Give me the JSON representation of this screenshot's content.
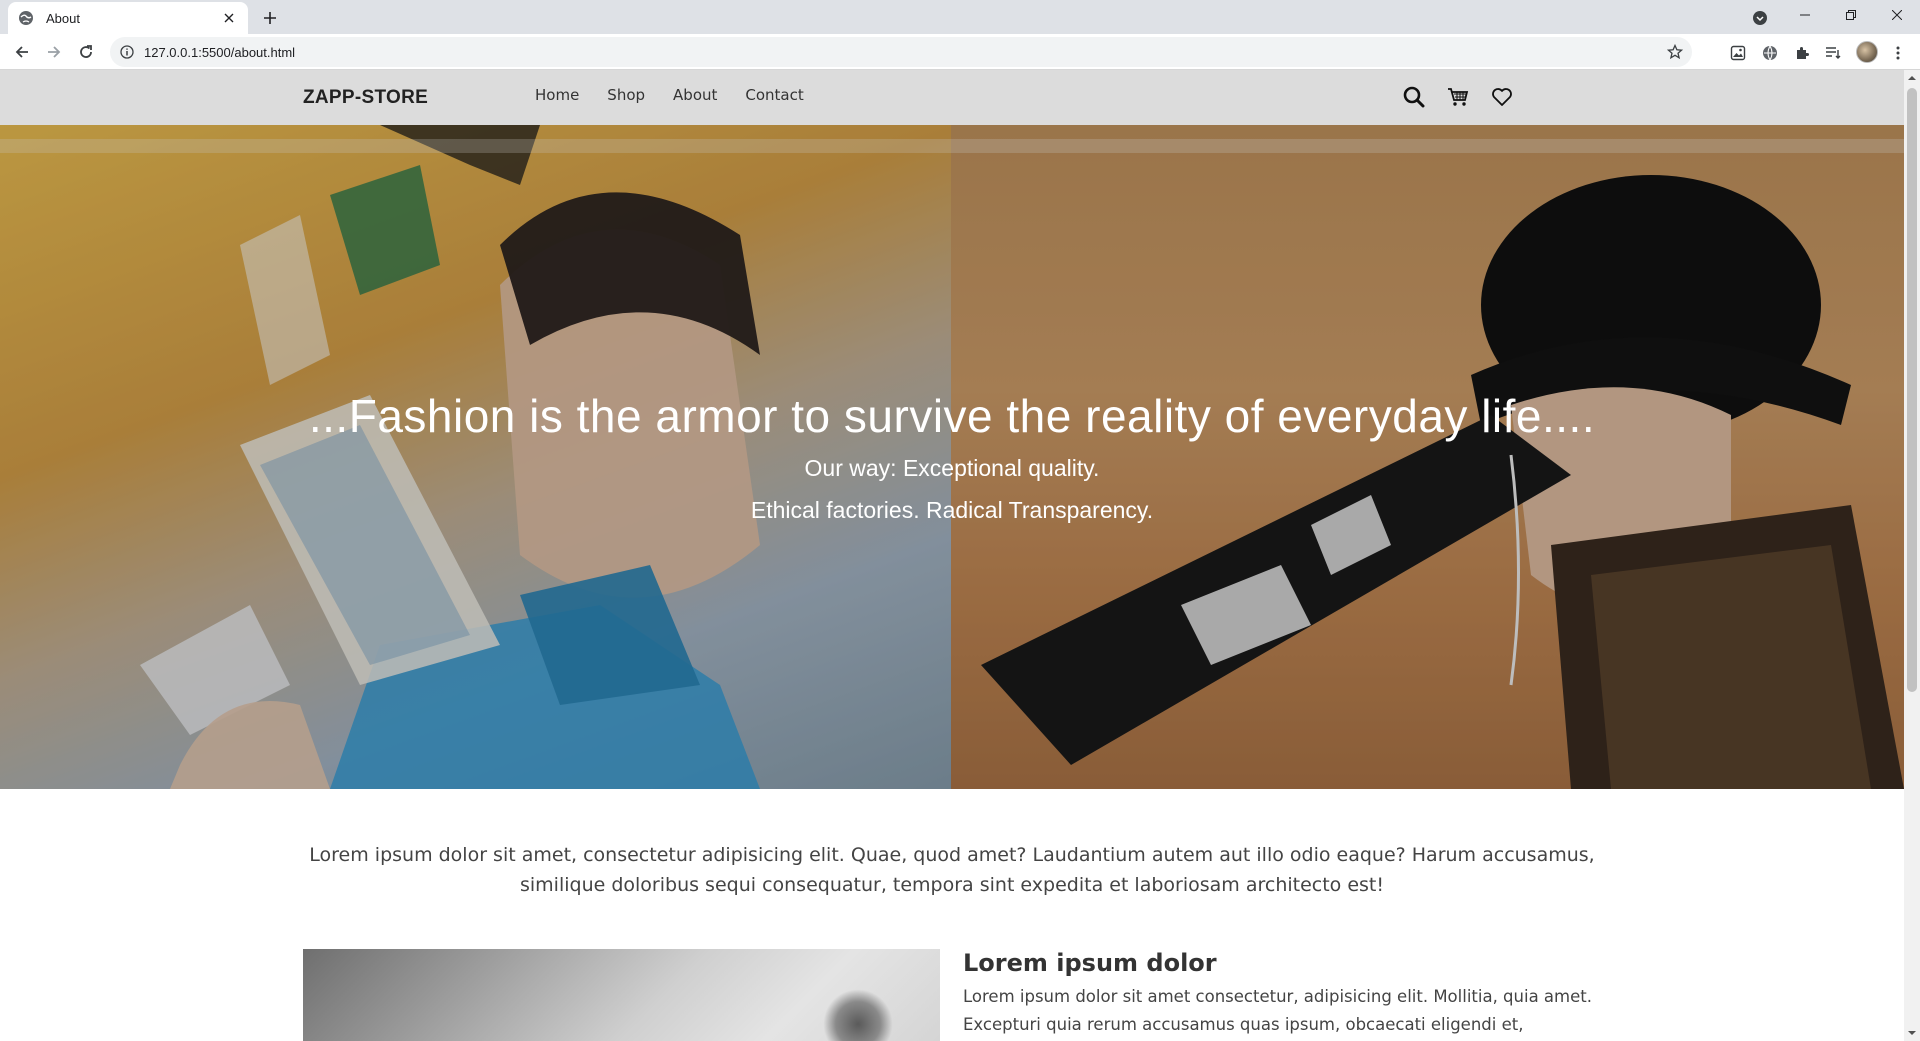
{
  "browser": {
    "tab_title": "About",
    "url": "127.0.0.1:5500/about.html"
  },
  "site": {
    "brand": "ZAPP-STORE",
    "nav": [
      {
        "label": "Home"
      },
      {
        "label": "Shop"
      },
      {
        "label": "About"
      },
      {
        "label": "Contact"
      }
    ],
    "header_icons": [
      "search-icon",
      "cart-icon",
      "heart-icon"
    ]
  },
  "hero": {
    "quote": "...Fashion is the armor to survive the reality of everyday life....",
    "line1": "Our way: Exceptional quality.",
    "line2": "Ethical factories. Radical Transparency."
  },
  "intro": {
    "text": "Lorem ipsum dolor sit amet, consectetur adipisicing elit. Quae, quod amet? Laudantium autem aut illo odio eaque? Harum accusamus, similique doloribus sequi consequatur, tempora sint expedita et laboriosam architecto est!"
  },
  "feature": {
    "title": "Lorem ipsum dolor",
    "text": "Lorem ipsum dolor sit amet consectetur, adipisicing elit. Mollitia, quia amet. Excepturi quia rerum accusamus quas ipsum, obcaecati eligendi et,"
  },
  "colors": {
    "header_bg": "#dcdcdc",
    "tabstrip_bg": "#dee1e6",
    "hero_text": "#ffffff"
  }
}
